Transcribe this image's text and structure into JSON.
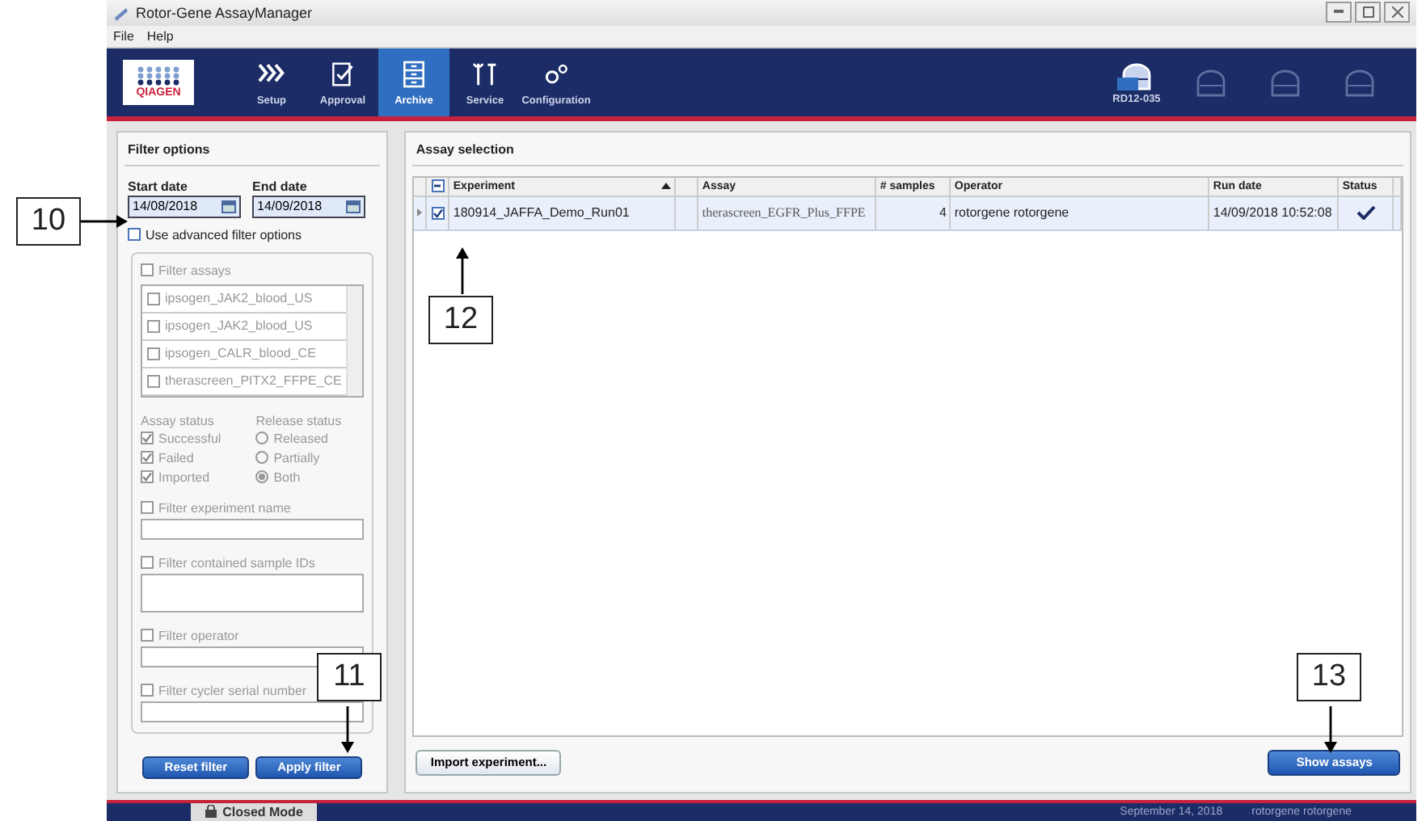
{
  "window": {
    "title": "Rotor-Gene AssayManager"
  },
  "menu": [
    "File",
    "Help"
  ],
  "logo": "QIAGEN",
  "toolbar": [
    {
      "label": "Setup",
      "selected": false
    },
    {
      "label": "Approval",
      "selected": false
    },
    {
      "label": "Archive",
      "selected": true
    },
    {
      "label": "Service",
      "selected": false
    },
    {
      "label": "Configuration",
      "selected": false
    }
  ],
  "cyclers": [
    {
      "label": "RD12-035",
      "active": true
    },
    {
      "active": false
    },
    {
      "active": false
    },
    {
      "active": false
    }
  ],
  "filter": {
    "title": "Filter options",
    "start_label": "Start date",
    "start_value": "14/08/2018",
    "end_label": "End date",
    "end_value": "14/09/2018",
    "advanced": {
      "label": "Use advanced filter options",
      "checked": false
    },
    "filter_assays": {
      "label": "Filter assays",
      "checked": false
    },
    "assays": [
      {
        "label": "ipsogen_JAK2_blood_US",
        "checked": false
      },
      {
        "label": "ipsogen_JAK2_blood_US",
        "checked": false
      },
      {
        "label": "ipsogen_CALR_blood_CE",
        "checked": false
      },
      {
        "label": "therascreen_PITX2_FFPE_CE",
        "checked": false
      }
    ],
    "assay_status_title": "Assay status",
    "release_status_title": "Release status",
    "assay_status": [
      {
        "label": "Successful",
        "checked": true
      },
      {
        "label": "Failed",
        "checked": true
      },
      {
        "label": "Imported",
        "checked": true
      }
    ],
    "release_status": [
      {
        "label": "Released",
        "selected": false
      },
      {
        "label": "Partially",
        "selected": false
      },
      {
        "label": "Both",
        "selected": true
      }
    ],
    "text_filters": [
      {
        "label": "Filter experiment name",
        "checked": false,
        "kind": "single"
      },
      {
        "label": "Filter contained sample IDs",
        "checked": false,
        "kind": "multi"
      },
      {
        "label": "Filter operator",
        "checked": false,
        "kind": "single"
      },
      {
        "label": "Filter cycler serial number",
        "checked": false,
        "kind": "single"
      }
    ],
    "buttons": [
      "Reset filter",
      "Apply filter"
    ]
  },
  "assay_selection": {
    "title": "Assay selection",
    "header_partial": true,
    "columns": [
      "Experiment",
      "Assay",
      "# samples",
      "Operator",
      "Run date",
      "Status"
    ],
    "rows": [
      {
        "experiment": "180914_JAFFA_Demo_Run01",
        "checked": true,
        "assay": "therascreen_EGFR_Plus_FFPE",
        "samples": "4",
        "operator": "rotorgene rotorgene",
        "run_date": "14/09/2018 10:52:08",
        "complete": true
      }
    ],
    "import_button": "Import experiment...",
    "show_button": "Show assays"
  },
  "status_bar": {
    "mode": "Closed Mode",
    "date": "September 14, 2018",
    "user": "rotorgene rotorgene"
  },
  "callouts": [
    {
      "label": "10"
    },
    {
      "label": "11"
    },
    {
      "label": "12"
    },
    {
      "label": "13"
    }
  ]
}
